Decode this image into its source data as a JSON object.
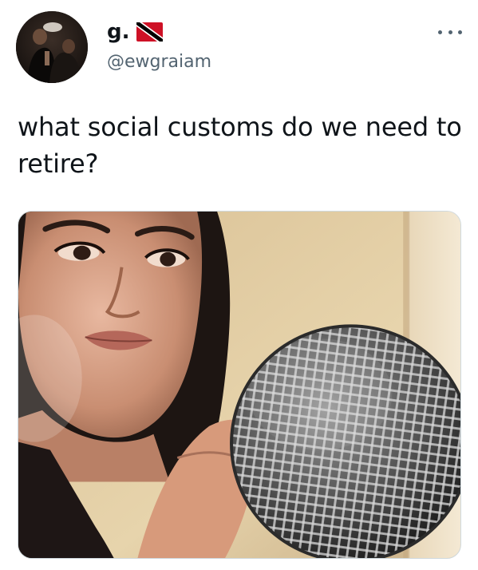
{
  "author": {
    "display_name": "g.",
    "handle": "@ewgraiam",
    "avatar_icon": "avatar-photo-icon",
    "flag_icon": "trinidad-and-tobago-flag-icon"
  },
  "tweet": {
    "text": "what social customs do we need to retire?"
  },
  "media": {
    "icon": "photo-woman-holding-microphone"
  },
  "more_icon": "more-options-icon",
  "colors": {
    "text_primary": "#0f1419",
    "text_secondary": "#536471",
    "border": "#cfd9de",
    "flag_red": "#ce1126",
    "flag_black": "#000000",
    "flag_white": "#ffffff"
  }
}
